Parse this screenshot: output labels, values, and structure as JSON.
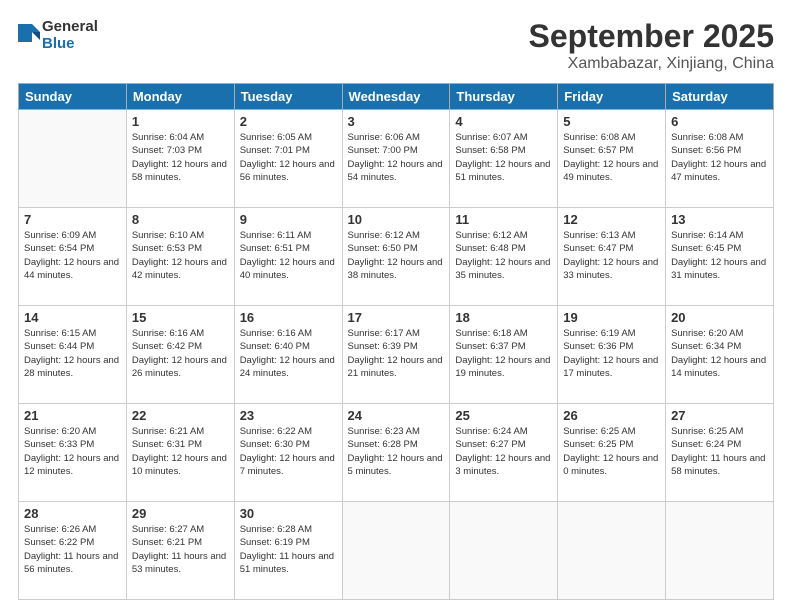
{
  "header": {
    "logo_line1": "General",
    "logo_line2": "Blue",
    "title": "September 2025",
    "subtitle": "Xambabazar, Xinjiang, China"
  },
  "days_of_week": [
    "Sunday",
    "Monday",
    "Tuesday",
    "Wednesday",
    "Thursday",
    "Friday",
    "Saturday"
  ],
  "weeks": [
    [
      {
        "day": "",
        "sunrise": "",
        "sunset": "",
        "daylight": ""
      },
      {
        "day": "1",
        "sunrise": "6:04 AM",
        "sunset": "7:03 PM",
        "daylight": "12 hours and 58 minutes."
      },
      {
        "day": "2",
        "sunrise": "6:05 AM",
        "sunset": "7:01 PM",
        "daylight": "12 hours and 56 minutes."
      },
      {
        "day": "3",
        "sunrise": "6:06 AM",
        "sunset": "7:00 PM",
        "daylight": "12 hours and 54 minutes."
      },
      {
        "day": "4",
        "sunrise": "6:07 AM",
        "sunset": "6:58 PM",
        "daylight": "12 hours and 51 minutes."
      },
      {
        "day": "5",
        "sunrise": "6:08 AM",
        "sunset": "6:57 PM",
        "daylight": "12 hours and 49 minutes."
      },
      {
        "day": "6",
        "sunrise": "6:08 AM",
        "sunset": "6:56 PM",
        "daylight": "12 hours and 47 minutes."
      }
    ],
    [
      {
        "day": "7",
        "sunrise": "6:09 AM",
        "sunset": "6:54 PM",
        "daylight": "12 hours and 44 minutes."
      },
      {
        "day": "8",
        "sunrise": "6:10 AM",
        "sunset": "6:53 PM",
        "daylight": "12 hours and 42 minutes."
      },
      {
        "day": "9",
        "sunrise": "6:11 AM",
        "sunset": "6:51 PM",
        "daylight": "12 hours and 40 minutes."
      },
      {
        "day": "10",
        "sunrise": "6:12 AM",
        "sunset": "6:50 PM",
        "daylight": "12 hours and 38 minutes."
      },
      {
        "day": "11",
        "sunrise": "6:12 AM",
        "sunset": "6:48 PM",
        "daylight": "12 hours and 35 minutes."
      },
      {
        "day": "12",
        "sunrise": "6:13 AM",
        "sunset": "6:47 PM",
        "daylight": "12 hours and 33 minutes."
      },
      {
        "day": "13",
        "sunrise": "6:14 AM",
        "sunset": "6:45 PM",
        "daylight": "12 hours and 31 minutes."
      }
    ],
    [
      {
        "day": "14",
        "sunrise": "6:15 AM",
        "sunset": "6:44 PM",
        "daylight": "12 hours and 28 minutes."
      },
      {
        "day": "15",
        "sunrise": "6:16 AM",
        "sunset": "6:42 PM",
        "daylight": "12 hours and 26 minutes."
      },
      {
        "day": "16",
        "sunrise": "6:16 AM",
        "sunset": "6:40 PM",
        "daylight": "12 hours and 24 minutes."
      },
      {
        "day": "17",
        "sunrise": "6:17 AM",
        "sunset": "6:39 PM",
        "daylight": "12 hours and 21 minutes."
      },
      {
        "day": "18",
        "sunrise": "6:18 AM",
        "sunset": "6:37 PM",
        "daylight": "12 hours and 19 minutes."
      },
      {
        "day": "19",
        "sunrise": "6:19 AM",
        "sunset": "6:36 PM",
        "daylight": "12 hours and 17 minutes."
      },
      {
        "day": "20",
        "sunrise": "6:20 AM",
        "sunset": "6:34 PM",
        "daylight": "12 hours and 14 minutes."
      }
    ],
    [
      {
        "day": "21",
        "sunrise": "6:20 AM",
        "sunset": "6:33 PM",
        "daylight": "12 hours and 12 minutes."
      },
      {
        "day": "22",
        "sunrise": "6:21 AM",
        "sunset": "6:31 PM",
        "daylight": "12 hours and 10 minutes."
      },
      {
        "day": "23",
        "sunrise": "6:22 AM",
        "sunset": "6:30 PM",
        "daylight": "12 hours and 7 minutes."
      },
      {
        "day": "24",
        "sunrise": "6:23 AM",
        "sunset": "6:28 PM",
        "daylight": "12 hours and 5 minutes."
      },
      {
        "day": "25",
        "sunrise": "6:24 AM",
        "sunset": "6:27 PM",
        "daylight": "12 hours and 3 minutes."
      },
      {
        "day": "26",
        "sunrise": "6:25 AM",
        "sunset": "6:25 PM",
        "daylight": "12 hours and 0 minutes."
      },
      {
        "day": "27",
        "sunrise": "6:25 AM",
        "sunset": "6:24 PM",
        "daylight": "11 hours and 58 minutes."
      }
    ],
    [
      {
        "day": "28",
        "sunrise": "6:26 AM",
        "sunset": "6:22 PM",
        "daylight": "11 hours and 56 minutes."
      },
      {
        "day": "29",
        "sunrise": "6:27 AM",
        "sunset": "6:21 PM",
        "daylight": "11 hours and 53 minutes."
      },
      {
        "day": "30",
        "sunrise": "6:28 AM",
        "sunset": "6:19 PM",
        "daylight": "11 hours and 51 minutes."
      },
      {
        "day": "",
        "sunrise": "",
        "sunset": "",
        "daylight": ""
      },
      {
        "day": "",
        "sunrise": "",
        "sunset": "",
        "daylight": ""
      },
      {
        "day": "",
        "sunrise": "",
        "sunset": "",
        "daylight": ""
      },
      {
        "day": "",
        "sunrise": "",
        "sunset": "",
        "daylight": ""
      }
    ]
  ]
}
